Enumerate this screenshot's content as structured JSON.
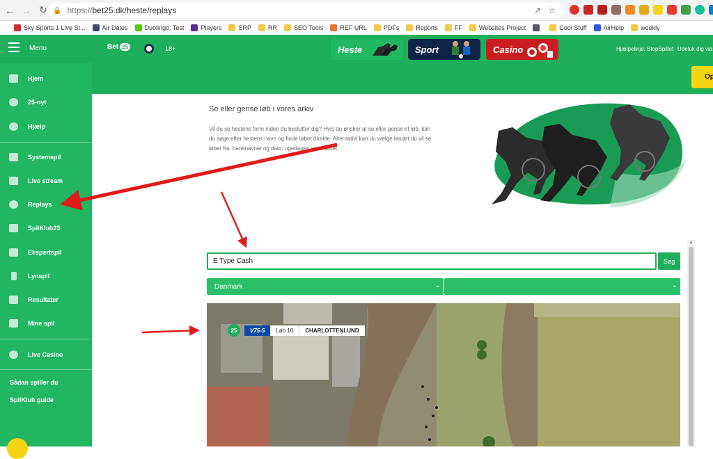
{
  "browser": {
    "url_scheme": "https://",
    "url_rest": "bet25.dk/heste/replays",
    "bookmarks": [
      {
        "label": "Sky Sports 1 Live St...",
        "icon_color": "#d62e2e"
      },
      {
        "label": "Air Dates",
        "icon_color": "#3b4a6b"
      },
      {
        "label": "Duolingo: Test",
        "icon_color": "#58cc02"
      },
      {
        "label": "Players",
        "icon_color": "#5b2d91"
      },
      {
        "label": "SRP",
        "icon_color": "#f2c94c"
      },
      {
        "label": "RR",
        "icon_color": "#f2c94c"
      },
      {
        "label": "SEO Tools",
        "icon_color": "#f2c94c"
      },
      {
        "label": "REF URL",
        "icon_color": "#e8742e"
      },
      {
        "label": "PDFs",
        "icon_color": "#f2c94c"
      },
      {
        "label": "Reports",
        "icon_color": "#f2c94c"
      },
      {
        "label": "FF",
        "icon_color": "#f2c94c"
      },
      {
        "label": "Websites Project",
        "icon_color": "#f2c94c"
      },
      {
        "label": "",
        "icon_color": "#556"
      },
      {
        "label": "Cool Stuff",
        "icon_color": "#f2c94c"
      },
      {
        "label": "AirHelp",
        "icon_color": "#2d5be3"
      },
      {
        "label": "weekly",
        "icon_color": "#f2c94c"
      }
    ]
  },
  "header": {
    "menu_label": "Menu",
    "logo_text": "Bet",
    "logo_badge": "25",
    "age_label": "18+",
    "tabs": {
      "heste": "Heste",
      "sport": "Sport",
      "casino": "Casino"
    },
    "helpline": "Hjælpelinje: StopSpillet",
    "self_exclusion": "Udeluk dig via R",
    "cta_label": "Opr"
  },
  "sidebar": {
    "items": [
      {
        "label": "Hjem"
      },
      {
        "label": "25-nyt"
      },
      {
        "label": "Hjælp"
      },
      {
        "label": "Systemspil"
      },
      {
        "label": "Live stream"
      },
      {
        "label": "Replays"
      },
      {
        "label": "SpilKlub25"
      },
      {
        "label": "Ekspertspil"
      },
      {
        "label": "Lynspil"
      },
      {
        "label": "Resultater"
      },
      {
        "label": "Mine spil"
      },
      {
        "label": "Live Casino"
      }
    ],
    "how_to_play": "Sådan spiller du",
    "club_guide": "SpilKlub guide"
  },
  "main": {
    "title": "Se eller gense løb i vores arkiv",
    "description": "Vil du se hestens form inden du beslutter dig? Hvis du ønsker at se eller gense et løb, kan du søge efter hestens navn og finde løbet direkte. Alternativt kan du vælge landet du vil se løbet fra, banenavnet og dato, ugedagen samt løbet.",
    "search_value": "E Type Cash",
    "search_button": "Søg",
    "country_selected": "Danmark",
    "track_selected": ""
  },
  "video": {
    "brand": "25",
    "game_type": "V75-5",
    "race_label": "Løb 10",
    "track_name": "CHARLOTTENLUND"
  },
  "colors": {
    "brand_green": "#1fae5b",
    "annotation_red": "#e01b1b",
    "yellow": "#f5d514"
  }
}
